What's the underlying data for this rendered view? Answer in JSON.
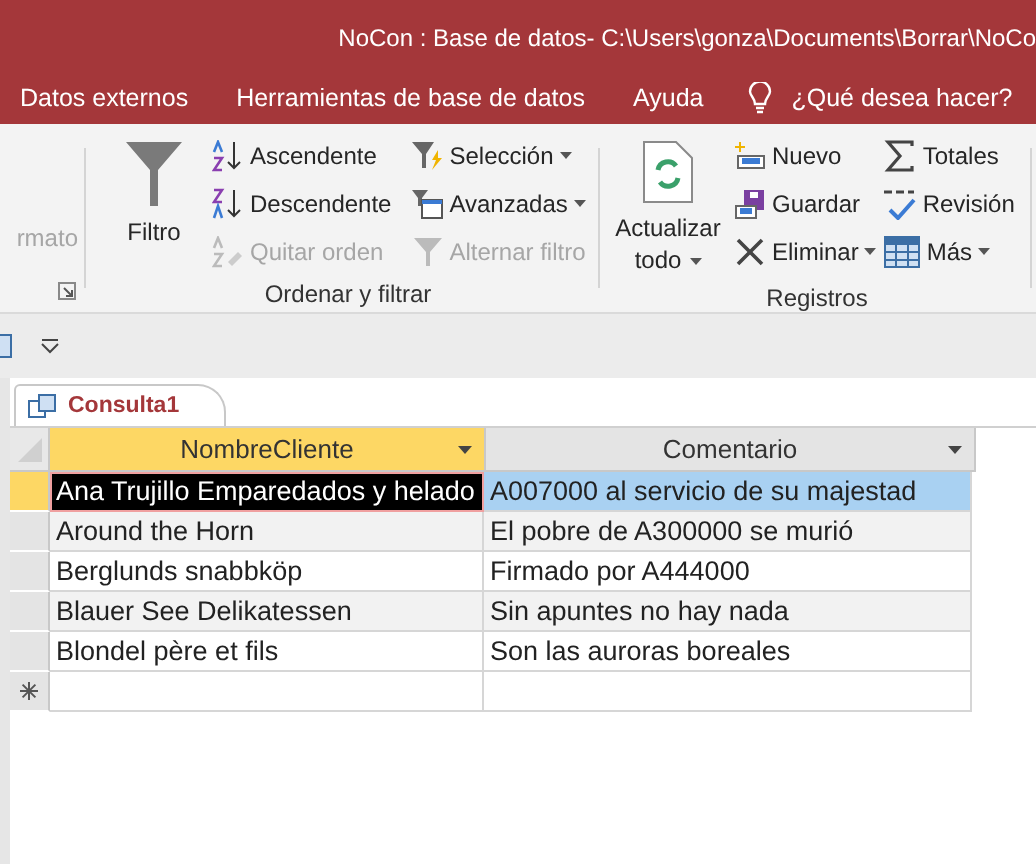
{
  "window": {
    "title": "NoCon : Base de datos- C:\\Users\\gonza\\Documents\\Borrar\\NoCo"
  },
  "menu": [
    {
      "label": "Datos externos"
    },
    {
      "label": "Herramientas de base de datos"
    },
    {
      "label": "Ayuda"
    }
  ],
  "tell_me": {
    "placeholder": "¿Qué desea hacer?"
  },
  "ribbon": [
    {
      "dialog_launcher": true,
      "columns": [
        [
          {
            "kind": "small",
            "label": "rmato",
            "disabled": true,
            "dropdown": false
          }
        ]
      ]
    },
    {
      "label": "Ordenar y filtrar",
      "columns": [
        [
          {
            "kind": "large",
            "label": "Filtro",
            "disabled": false,
            "dropdown": false
          }
        ],
        [
          {
            "kind": "small",
            "label": "Ascendente",
            "disabled": false,
            "dropdown": false
          },
          {
            "kind": "small",
            "label": "Descendente",
            "disabled": false,
            "dropdown": false
          },
          {
            "kind": "small",
            "label": "Quitar orden",
            "disabled": true,
            "dropdown": false
          }
        ],
        [
          {
            "kind": "small",
            "label": "Selección",
            "disabled": false,
            "dropdown": true
          },
          {
            "kind": "small",
            "label": "Avanzadas",
            "disabled": false,
            "dropdown": true
          },
          {
            "kind": "small",
            "label": "Alternar filtro",
            "disabled": true,
            "dropdown": false
          }
        ]
      ]
    },
    {
      "label": "Registros",
      "columns": [
        [
          {
            "kind": "large",
            "label": "Actualizar todo",
            "disabled": false,
            "dropdown": true
          }
        ],
        [
          {
            "kind": "small",
            "label": "Nuevo",
            "disabled": false,
            "dropdown": false
          },
          {
            "kind": "small",
            "label": "Guardar",
            "disabled": false,
            "dropdown": false
          },
          {
            "kind": "small",
            "label": "Eliminar",
            "disabled": false,
            "dropdown": true
          }
        ],
        [
          {
            "kind": "small",
            "label": "Totales",
            "disabled": false,
            "dropdown": false
          },
          {
            "kind": "small",
            "label": "Revisión",
            "disabled": false,
            "dropdown": false
          },
          {
            "kind": "small",
            "label": "Más",
            "disabled": false,
            "dropdown": true
          }
        ]
      ]
    }
  ],
  "doc_tabs": [
    {
      "label": "Consulta1",
      "selected": true
    }
  ],
  "table": {
    "columns": [
      {
        "label": "NombreCliente",
        "selected": true
      },
      {
        "label": "Comentario",
        "selected": false
      }
    ],
    "rows": [
      {
        "selected": true,
        "cells": [
          {
            "text": "Ana Trujillo Emparedados y helado",
            "focused": true
          },
          {
            "text": "A007000 al servicio de su majestad",
            "focused": false
          }
        ]
      },
      {
        "selected": false,
        "cells": [
          {
            "text": "Around the Horn",
            "focused": false
          },
          {
            "text": "El pobre de A300000 se murió",
            "focused": false
          }
        ]
      },
      {
        "selected": false,
        "cells": [
          {
            "text": "Berglunds snabbköp",
            "focused": false
          },
          {
            "text": "Firmado por A444000",
            "focused": false
          }
        ]
      },
      {
        "selected": false,
        "cells": [
          {
            "text": "Blauer See Delikatessen",
            "focused": false
          },
          {
            "text": "Sin apuntes no hay nada",
            "focused": false
          }
        ]
      },
      {
        "selected": false,
        "cells": [
          {
            "text": "Blondel père et fils",
            "focused": false
          },
          {
            "text": "Son las auroras boreales",
            "focused": false
          }
        ]
      }
    ],
    "new_row": true
  }
}
